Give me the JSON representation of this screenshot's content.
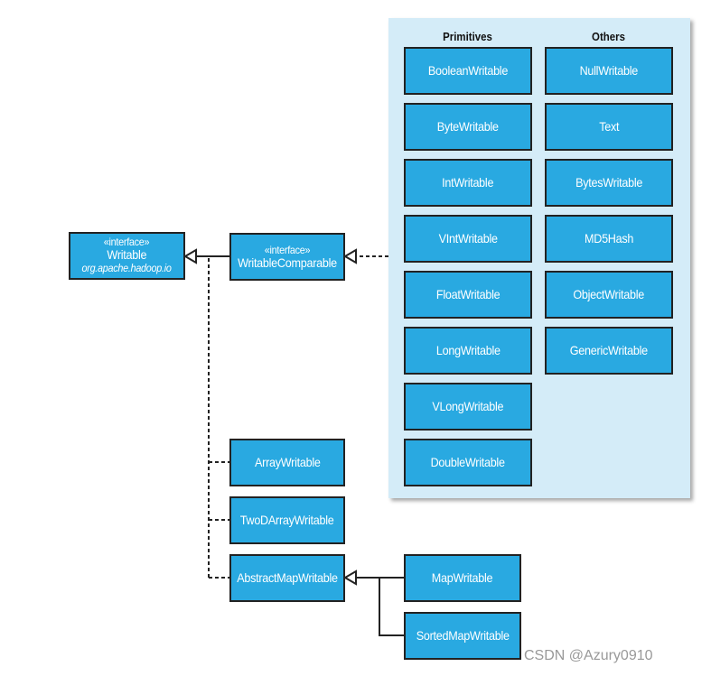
{
  "writable": {
    "stereotype": "«interface»",
    "name": "Writable",
    "package": "org.apache.hadoop.io"
  },
  "comparable": {
    "stereotype": "«interface»",
    "name": "WritableComparable"
  },
  "panel": {
    "primitives_header": "Primitives",
    "others_header": "Others",
    "primitives": [
      "BooleanWritable",
      "ByteWritable",
      "IntWritable",
      "VIntWritable",
      "FloatWritable",
      "LongWritable",
      "VLongWritable",
      "DoubleWritable"
    ],
    "others": [
      "NullWritable",
      "Text",
      "BytesWritable",
      "MD5Hash",
      "ObjectWritable",
      "GenericWritable"
    ]
  },
  "direct": [
    "ArrayWritable",
    "TwoDArrayWritable",
    "AbstractMapWritable"
  ],
  "maps": [
    "MapWritable",
    "SortedMapWritable"
  ],
  "watermark": "CSDN @Azury0910",
  "colors": {
    "box": "#29a9e1",
    "panel": "#d4ecf8",
    "border": "#222222"
  }
}
